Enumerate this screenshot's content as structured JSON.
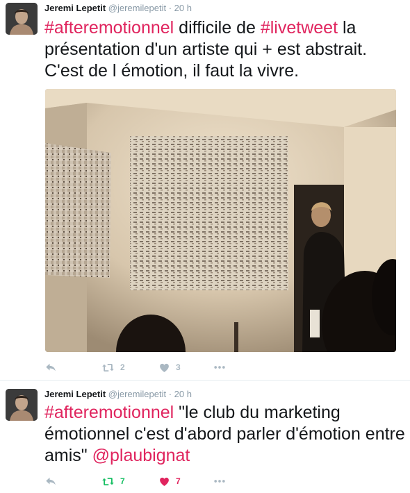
{
  "tweets": [
    {
      "author_name": "Jeremi Lepetit",
      "handle": "@jeremilepetit",
      "separator": "·",
      "time": "20 h",
      "text": {
        "hashtag1": "#afteremotionnel",
        "part1": " difficile de ",
        "hashtag2": "#livetweet",
        "part2": " la présentation d'un artiste qui + est abstrait. C'est de l émotion, il faut la vivre."
      },
      "retweet_count": "2",
      "like_count": "3",
      "retweet_active": false,
      "like_active": false
    },
    {
      "author_name": "Jeremi Lepetit",
      "handle": "@jeremilepetit",
      "separator": "·",
      "time": "20 h",
      "text": {
        "hashtag1": "#afteremotionnel",
        "part1": " \"le club du marketing émotionnel c'est d'abord parler d'émotion entre amis\" ",
        "mention": "@plaubignat"
      },
      "retweet_count": "7",
      "like_count": "7",
      "retweet_active": true,
      "like_active": true
    }
  ],
  "colors": {
    "hashtag": "#e0245e",
    "action_gray": "#aab8c2",
    "retweet_green": "#17bf63",
    "like_red": "#e0245e",
    "muted_text": "#8899a6"
  },
  "icons": {
    "reply": "reply-icon",
    "retweet": "retweet-icon",
    "like": "heart-icon",
    "more": "more-icon"
  }
}
